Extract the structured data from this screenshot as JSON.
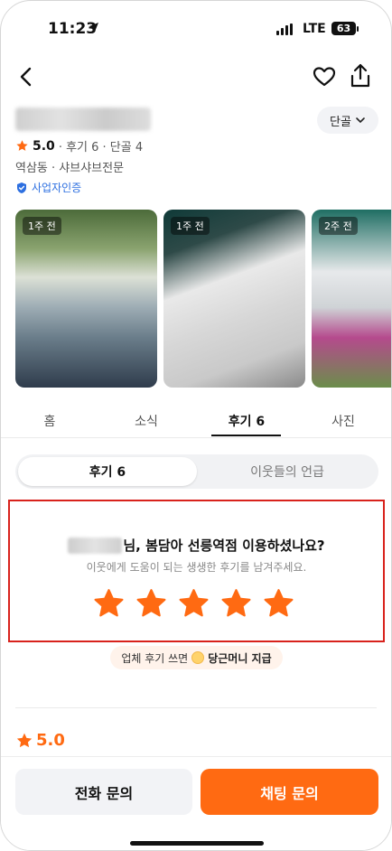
{
  "status_bar": {
    "time": "11:23",
    "network": "LTE",
    "battery": "63"
  },
  "store": {
    "rating": "5.0",
    "meta": "· 후기 6 · 단골 4",
    "category": "역삼동 · 샤브샤브전문",
    "verified_label": "사업자인증",
    "regular_label": "단골"
  },
  "photos": [
    {
      "badge": "1주 전"
    },
    {
      "badge": "1주 전"
    },
    {
      "badge": "2주 전"
    }
  ],
  "tabs": [
    {
      "label": "홈"
    },
    {
      "label": "소식"
    },
    {
      "label": "후기 6"
    },
    {
      "label": "사진"
    }
  ],
  "segment": {
    "active": "후기 6",
    "inactive": "이웃들의 언급"
  },
  "review_prompt": {
    "title": "님, 봄담아 선릉역점 이용하셨나요?",
    "subtitle": "이웃에게 도움이 되는 생생한 후기를 남겨주세요."
  },
  "reward": {
    "prefix": "업체 후기 쓰면",
    "highlight": "당근머니 지급"
  },
  "score": "5.0",
  "bottom": {
    "call_label": "전화 문의",
    "chat_label": "채팅 문의"
  },
  "colors": {
    "accent": "#ff6a12",
    "verified": "#2d6fe0",
    "highlight_border": "#d8221c"
  }
}
